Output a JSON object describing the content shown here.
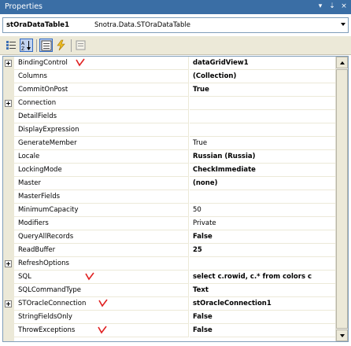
{
  "window": {
    "title": "Properties",
    "pin_glyph": "▾",
    "autohide_glyph": "⇣",
    "close_glyph": "×"
  },
  "object_selector": {
    "name": "stOraDataTable1",
    "type": "Snotra.Data.STOraDataTable"
  },
  "toolbar": {
    "buttons": [
      {
        "icon": "categorized-icon",
        "checked": false
      },
      {
        "icon": "alphabetical-icon",
        "checked": true
      },
      {
        "icon": "properties-icon",
        "checked": true
      },
      {
        "icon": "events-icon",
        "checked": false
      },
      {
        "icon": "property-pages-icon",
        "checked": false
      }
    ]
  },
  "properties": [
    {
      "name": "BindingControl",
      "value": "dataGridView1",
      "bold": true,
      "expandable": true,
      "checked": true
    },
    {
      "name": "Columns",
      "value": "(Collection)",
      "bold": true,
      "expandable": false,
      "checked": false
    },
    {
      "name": "CommitOnPost",
      "value": "True",
      "bold": true,
      "expandable": false,
      "checked": false
    },
    {
      "name": "Connection",
      "value": "",
      "bold": false,
      "expandable": true,
      "checked": false
    },
    {
      "name": "DetailFields",
      "value": "",
      "bold": false,
      "expandable": false,
      "checked": false
    },
    {
      "name": "DisplayExpression",
      "value": "",
      "bold": false,
      "expandable": false,
      "checked": false
    },
    {
      "name": "GenerateMember",
      "value": "True",
      "bold": false,
      "expandable": false,
      "checked": false
    },
    {
      "name": "Locale",
      "value": "Russian (Russia)",
      "bold": true,
      "expandable": false,
      "checked": false
    },
    {
      "name": "LockingMode",
      "value": "CheckImmediate",
      "bold": true,
      "expandable": false,
      "checked": false
    },
    {
      "name": "Master",
      "value": "(none)",
      "bold": true,
      "expandable": false,
      "checked": false
    },
    {
      "name": "MasterFields",
      "value": "",
      "bold": false,
      "expandable": false,
      "checked": false
    },
    {
      "name": "MinimumCapacity",
      "value": "50",
      "bold": false,
      "expandable": false,
      "checked": false
    },
    {
      "name": "Modifiers",
      "value": "Private",
      "bold": false,
      "expandable": false,
      "checked": false
    },
    {
      "name": "QueryAllRecords",
      "value": "False",
      "bold": true,
      "expandable": false,
      "checked": false
    },
    {
      "name": "ReadBuffer",
      "value": "25",
      "bold": true,
      "expandable": false,
      "checked": false
    },
    {
      "name": "RefreshOptions",
      "value": "",
      "bold": false,
      "expandable": true,
      "checked": false
    },
    {
      "name": "SQL",
      "value": "select c.rowid, c.* from colors c",
      "bold": true,
      "expandable": false,
      "checked": true
    },
    {
      "name": "SQLCommandType",
      "value": "Text",
      "bold": true,
      "expandable": false,
      "checked": false
    },
    {
      "name": "STOracleConnection",
      "value": "stOracleConnection1",
      "bold": true,
      "expandable": true,
      "checked": true
    },
    {
      "name": "StringFieldsOnly",
      "value": "False",
      "bold": true,
      "expandable": false,
      "checked": false
    },
    {
      "name": "ThrowExceptions",
      "value": "False",
      "bold": true,
      "expandable": false,
      "checked": true
    }
  ],
  "colors": {
    "titlebar": "#3a6ea5",
    "check_mark": "#e02020",
    "gutter": "#ece9d8"
  }
}
